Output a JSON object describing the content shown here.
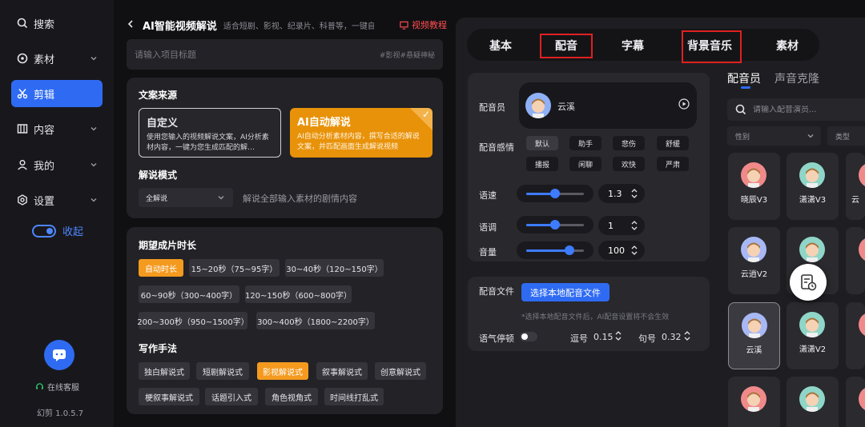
{
  "sidebar": {
    "items": [
      {
        "label": "搜索",
        "icon": "search-icon"
      },
      {
        "label": "素材",
        "icon": "material-icon"
      },
      {
        "label": "剪辑",
        "icon": "scissors-icon"
      },
      {
        "label": "内容",
        "icon": "content-icon"
      },
      {
        "label": "我的",
        "icon": "user-icon"
      },
      {
        "label": "设置",
        "icon": "gear-icon"
      }
    ],
    "collapse_label": "收起",
    "service_label": "在线客服",
    "version": "幻剪 1.0.5.7"
  },
  "header": {
    "title": "AI智能视频解说",
    "subtitle": "适合短剧、影视、纪录片、科普等，一键自动生…",
    "tutorial": "视频教程"
  },
  "title_input": {
    "placeholder": "请输入项目标题",
    "tags": "#影视#悬疑神秘"
  },
  "copy_source": {
    "heading": "文案来源",
    "custom_title": "自定义",
    "custom_desc": "使用您输入的视频解说文案，AI分析素材内容，一键为您生成匹配的解…",
    "ai_title": "AI自动解说",
    "ai_desc": "AI自动分析素材内容，撰写合适的解说文案，并匹配画面生成解说视频",
    "mode_heading": "解说模式",
    "mode_value": "全解说",
    "mode_desc": "解说全部输入素材的剧情内容"
  },
  "duration": {
    "heading": "期望成片时长",
    "options": [
      "自动时长",
      "15~20秒（75~95字）",
      "30~40秒（120~150字）",
      "60~90秒（300~400字）",
      "120~150秒（600~800字）",
      "200~300秒（950~1500字）",
      "300~400秒（1800~2200字）"
    ]
  },
  "writing": {
    "heading": "写作手法",
    "options": [
      "独白解说式",
      "短剧解说式",
      "影视解说式",
      "叙事解说式",
      "创意解说式",
      "梗叙事解说式",
      "话题引入式",
      "角色视角式",
      "时间线打乱式"
    ]
  },
  "tabs": [
    "基本",
    "配音",
    "字幕",
    "背景音乐",
    "素材"
  ],
  "voice": {
    "voice_label": "配音员",
    "voice_name": "云溪",
    "emotion_label": "配音感情",
    "emotions": [
      "默认",
      "助手",
      "悲伤",
      "舒缓",
      "播报",
      "闲聊",
      "欢快",
      "严肃"
    ],
    "speed_label": "语速",
    "speed_value": "1.3",
    "speed": 0.5,
    "pitch_label": "语调",
    "pitch_value": "1",
    "pitch": 0.5,
    "volume_label": "音量",
    "volume_value": "100",
    "volume": 0.75,
    "file_label": "配音文件",
    "file_button": "选择本地配音文件",
    "file_note": "*选择本地配音文件后，AI配音设置将不会生效",
    "pause_label": "语气停顿",
    "comma_label": "逗号",
    "comma_value": "0.15",
    "period_label": "句号",
    "period_value": "0.32"
  },
  "library": {
    "tab_voice": "配音员",
    "tab_clone": "声音克隆",
    "search_placeholder": "请输入配音演员...",
    "filter_gender": "性别",
    "filter_type": "类型",
    "cards": [
      "晓辰V3",
      "潇潇V3",
      "云",
      "云逍V2",
      "",
      "",
      "云溪",
      "潇潇V2",
      "",
      "",
      "",
      ""
    ]
  },
  "colors": {
    "accent_blue": "#2f6bf2",
    "accent_orange": "#f39a1f",
    "highlight_red": "#e02020"
  }
}
